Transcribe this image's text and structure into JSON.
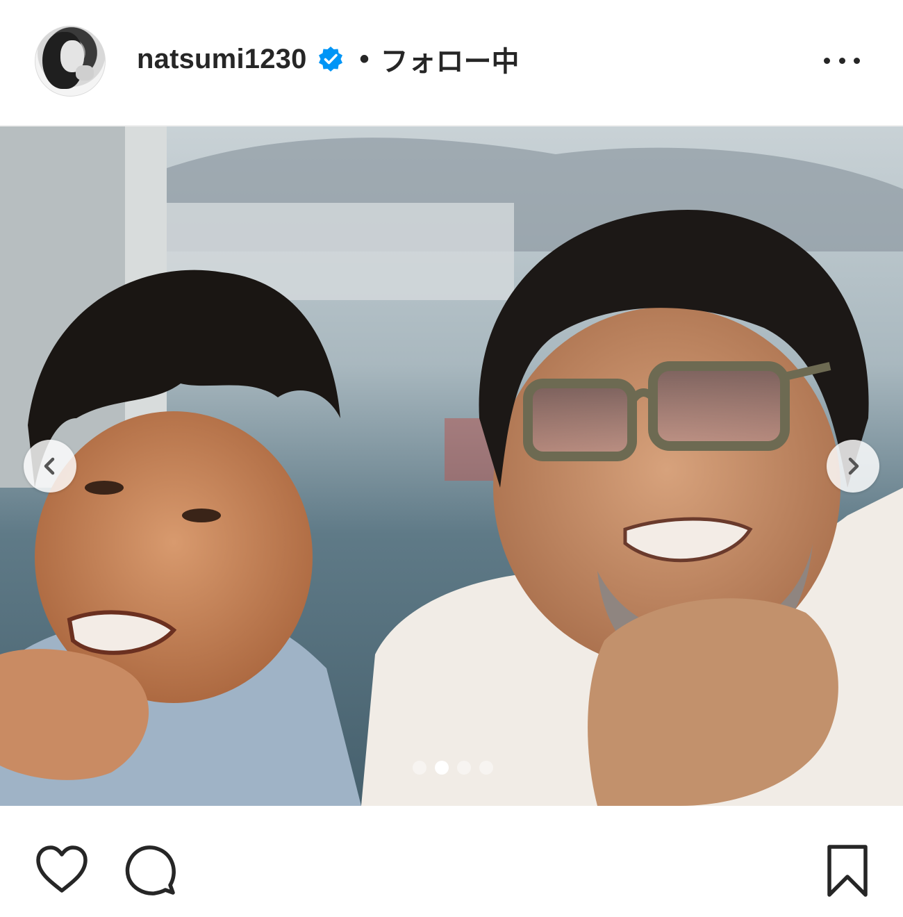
{
  "post": {
    "username": "natsumi1230",
    "separator": "•",
    "follow_status": "フォロー中",
    "verified": true
  },
  "carousel": {
    "slide_count": 4,
    "active_index": 1
  },
  "icons": {
    "verified": "verified-badge-icon",
    "more": "more-options-icon",
    "prev": "chevron-left-icon",
    "next": "chevron-right-icon",
    "like": "heart-icon",
    "comment": "comment-bubble-icon",
    "save": "bookmark-icon"
  },
  "colors": {
    "verified_blue": "#0095f6",
    "text": "#262626",
    "background": "#ffffff"
  }
}
